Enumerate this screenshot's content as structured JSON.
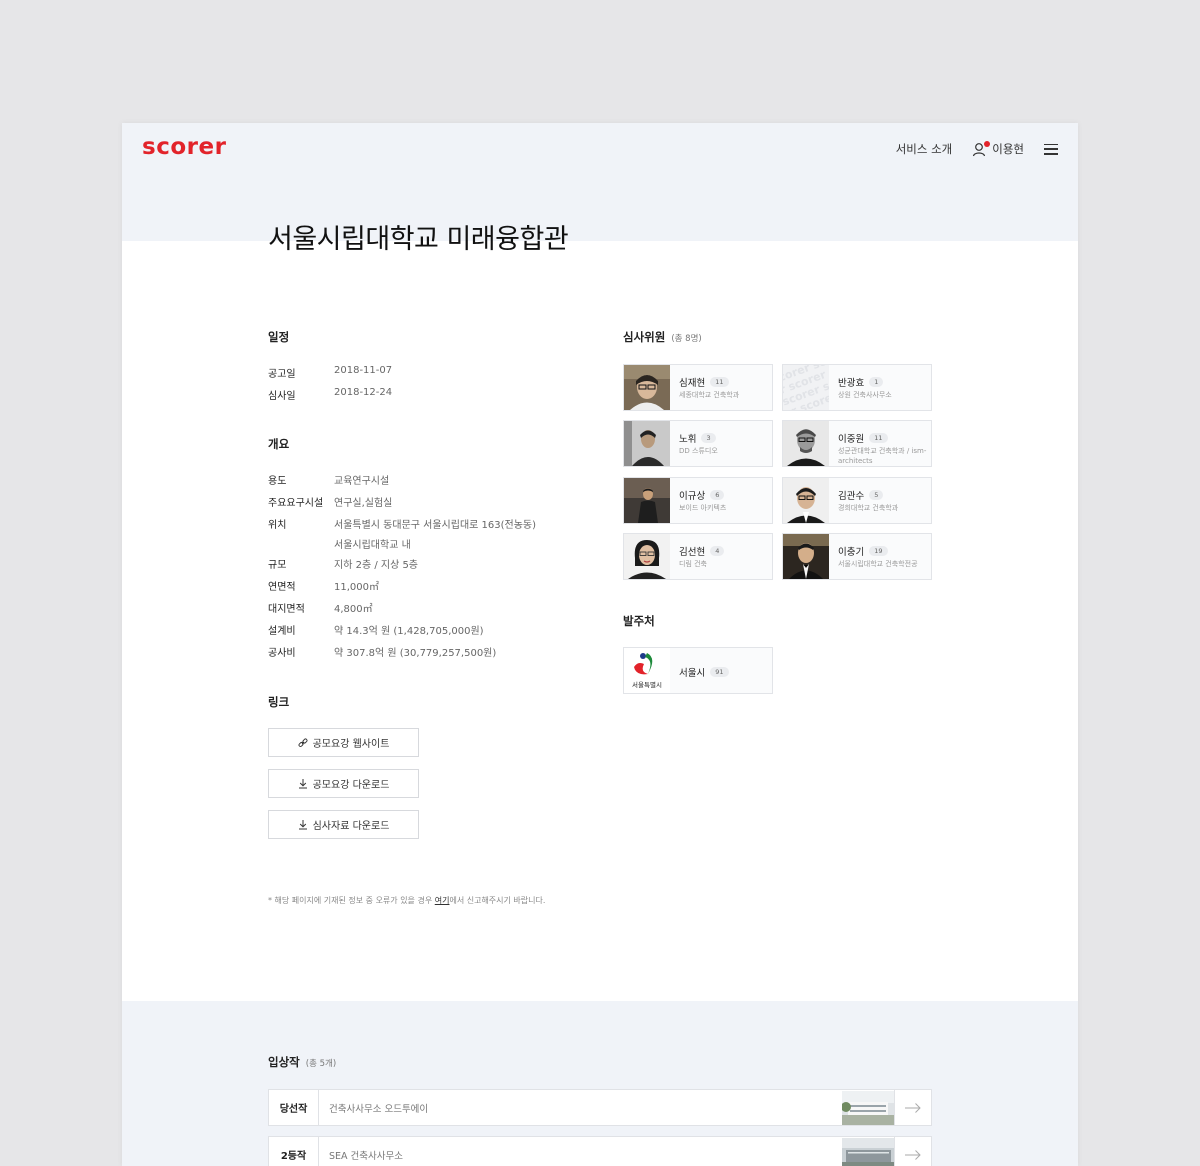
{
  "header": {
    "logo": "scorer",
    "nav_service": "서비스 소개",
    "user_name": "이용현"
  },
  "page_title": "서울시립대학교 미래융합관",
  "schedule": {
    "heading": "일정",
    "rows": [
      {
        "label": "공고일",
        "value": "2018-11-07"
      },
      {
        "label": "심사일",
        "value": "2018-12-24"
      }
    ]
  },
  "overview": {
    "heading": "개요",
    "use_label": "용도",
    "use_value": "교육연구시설",
    "facility_label": "주요요구시설",
    "facility_value": "연구실,실험실",
    "location_label": "위치",
    "location_line1": "서울특별시 동대문구 서울시립대로 163(전농동)",
    "location_line2": "서울시립대학교 내",
    "scale_label": "규모",
    "scale_value": "지하 2층 / 지상 5층",
    "floor_area_label": "연면적",
    "floor_area_value": "11,000㎡",
    "site_area_label": "대지면적",
    "site_area_value": "4,800㎡",
    "design_fee_label": "설계비",
    "design_fee_value": "약 14.3억 원 (1,428,705,000원)",
    "construction_label": "공사비",
    "construction_value": "약 307.8억 원 (30,779,257,500원)"
  },
  "links": {
    "heading": "링크",
    "website": "공모요강 웹사이트",
    "download_guide": "공모요강 다운로드",
    "download_review": "심사자료 다운로드"
  },
  "notice": {
    "before": "* 해당 페이지에 기재된 정보 중 오류가 있을 경우 ",
    "link": "여기",
    "after": "에서 신고해주시기 바랍니다."
  },
  "jury": {
    "heading": "심사위원",
    "total": "(총 8명)",
    "members": [
      {
        "name": "심재현",
        "count": "11",
        "affiliation": "세종대학교 건축학과"
      },
      {
        "name": "반광효",
        "count": "1",
        "affiliation": "상원 건축사사무소"
      },
      {
        "name": "노휘",
        "count": "3",
        "affiliation": "DD 스튜디오"
      },
      {
        "name": "이중원",
        "count": "11",
        "affiliation": "성균관대학교 건축학과 / ism-architects"
      },
      {
        "name": "이규상",
        "count": "6",
        "affiliation": "보이드 아키텍츠"
      },
      {
        "name": "김관수",
        "count": "5",
        "affiliation": "경희대학교 건축학과"
      },
      {
        "name": "김선현",
        "count": "4",
        "affiliation": "디림 건축"
      },
      {
        "name": "이충기",
        "count": "19",
        "affiliation": "서울시립대학교 건축학전공"
      }
    ]
  },
  "client": {
    "heading": "발주처",
    "name": "서울시",
    "count": "91",
    "logo_text": "서울특별시"
  },
  "awards": {
    "heading": "입상작",
    "total": "(총 5개)",
    "rows": [
      {
        "rank": "당선작",
        "office": "건축사사무소 오드투에이"
      },
      {
        "rank": "2등작",
        "office": "SEA 건축사사무소"
      }
    ]
  },
  "colors": {
    "brand": "#e2232a",
    "band": "#f0f3f8"
  }
}
